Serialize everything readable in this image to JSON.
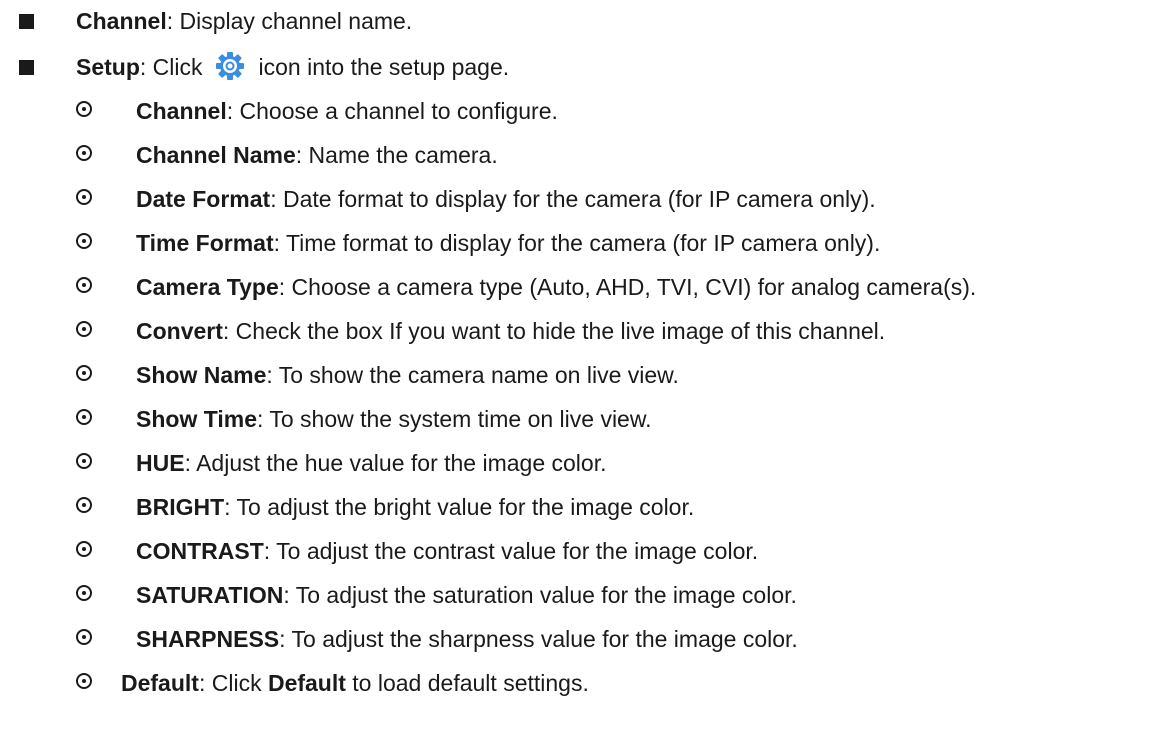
{
  "items": [
    {
      "term": "Channel",
      "desc": ": Display channel name."
    },
    {
      "term": "Setup",
      "desc_pre": ": Click",
      "desc_post": "icon into the setup page.",
      "icon": "gear-icon",
      "icon_color": "#3b8de0"
    },
    {
      "term": "Channel",
      "desc": ": Choose a channel to configure."
    },
    {
      "term": "Channel Name",
      "desc": ": Name the camera."
    },
    {
      "term": "Date Format",
      "desc": ": Date format to display for the camera (for IP camera only)."
    },
    {
      "term": "Time Format",
      "desc": ": Time format to display for the camera (for IP camera only)."
    },
    {
      "term": "Camera Type",
      "desc": ": Choose a camera type (Auto, AHD, TVI, CVI) for analog camera(s)."
    },
    {
      "term": "Convert",
      "desc": ": Check the box If you want to hide the live image of this channel."
    },
    {
      "term": "Show Name",
      "desc": ": To show the camera name on live view."
    },
    {
      "term": "Show Time",
      "desc": ": To show the system time on live view."
    },
    {
      "term": "HUE",
      "desc": ": Adjust the hue value for the image color."
    },
    {
      "term": "BRIGHT",
      "desc": ": To adjust the bright value for the image color."
    },
    {
      "term": "CONTRAST",
      "desc": ": To adjust the contrast value for the image color."
    },
    {
      "term": "SATURATION",
      "desc": ": To adjust the saturation value for the image color."
    },
    {
      "term": "SHARPNESS",
      "desc": ": To adjust the sharpness value for the image color."
    },
    {
      "term": "Default",
      "desc_pre": ": Click ",
      "term2": "Default",
      "desc_post": " to load default settings."
    }
  ]
}
